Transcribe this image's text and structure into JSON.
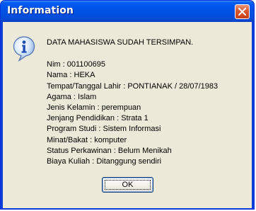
{
  "window": {
    "title": "Information",
    "close_icon": "close-icon",
    "accent_color": "#0054e3",
    "close_color": "#d6522c"
  },
  "dialog": {
    "icon": "info-icon",
    "headline": "DATA MAHASISWA SUDAH TERSIMPAN.",
    "lines": [
      "Nim : 001100695",
      "Nama : HEKA",
      "Tempat/Tanggal Lahir : PONTIANAK / 28/07/1983",
      "Agama : Islam",
      "Jenis Kelamin : perempuan",
      "Jenjang Pendidikan : Strata 1",
      "Program Studi : Sistem Informasi",
      "Minat/Bakat : komputer",
      "Status Perkawinan : Belum Menikah",
      "Biaya Kuliah : Ditanggung sendiri"
    ],
    "ok_label": "OK"
  }
}
